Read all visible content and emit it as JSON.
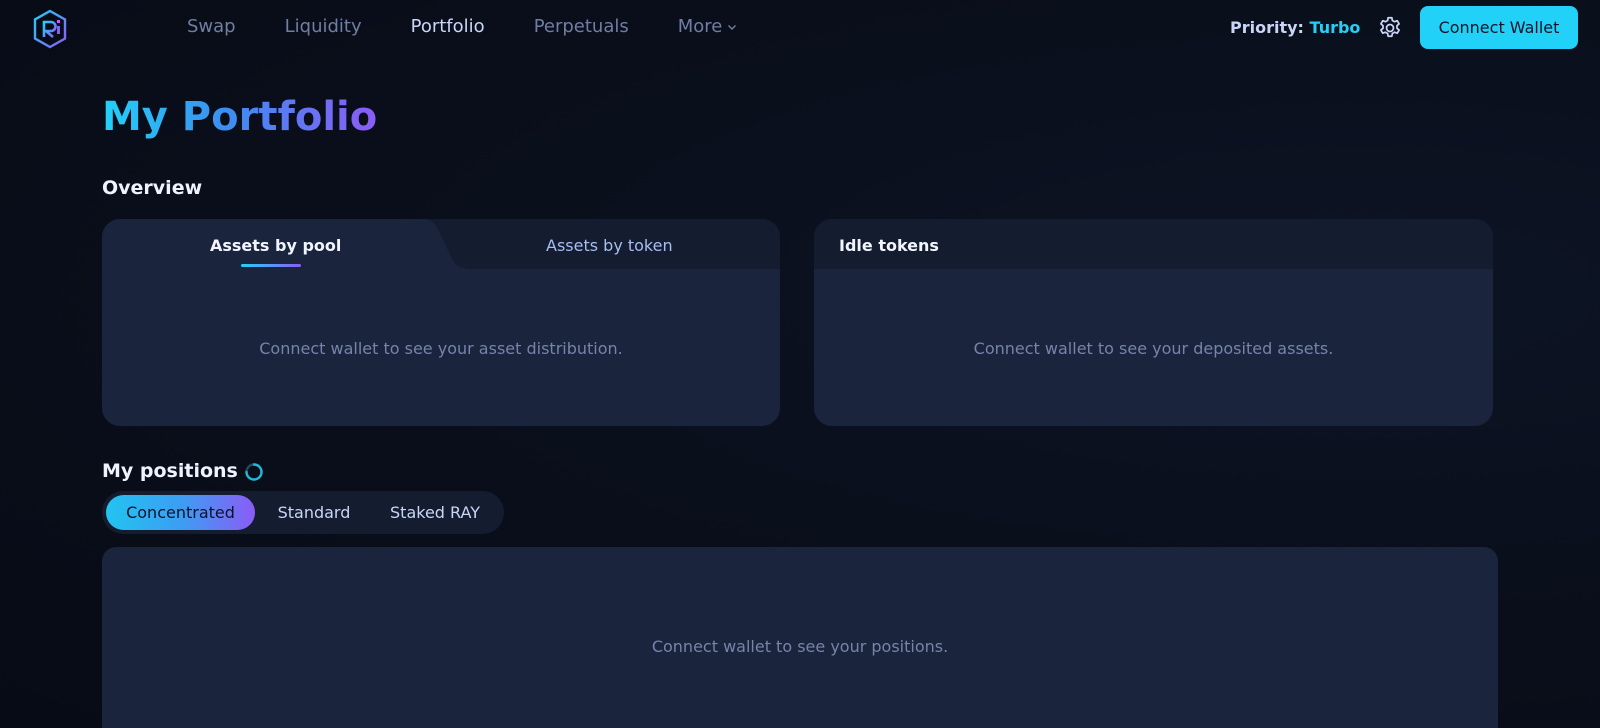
{
  "nav": {
    "links": [
      {
        "label": "Swap",
        "active": false
      },
      {
        "label": "Liquidity",
        "active": false
      },
      {
        "label": "Portfolio",
        "active": true
      },
      {
        "label": "Perpetuals",
        "active": false
      },
      {
        "label": "More",
        "active": false
      }
    ],
    "priority_label": "Priority:",
    "priority_value": "Turbo",
    "connect_label": "Connect Wallet"
  },
  "page": {
    "title": "My Portfolio",
    "overview_label": "Overview",
    "positions_label": "My positions"
  },
  "assets_card": {
    "tabs": [
      {
        "label": "Assets by pool",
        "active": true
      },
      {
        "label": "Assets by token",
        "active": false
      }
    ],
    "message": "Connect wallet to see your asset distribution."
  },
  "idle_card": {
    "title": "Idle tokens",
    "message": "Connect wallet to see your deposited assets."
  },
  "positions": {
    "tabs": [
      {
        "label": "Concentrated",
        "active": true
      },
      {
        "label": "Standard",
        "active": false
      },
      {
        "label": "Staked RAY",
        "active": false
      }
    ],
    "message": "Connect wallet to see your positions."
  },
  "colors": {
    "accent": "#22d1f8",
    "accent_purple": "#8b5cf6",
    "card": "#1b243d",
    "background": "#0a0f1c"
  },
  "icons": {
    "logo": "raydium-logo-icon",
    "more": "chevron-down-icon",
    "settings": "gear-icon",
    "loading": "spinner-icon"
  }
}
